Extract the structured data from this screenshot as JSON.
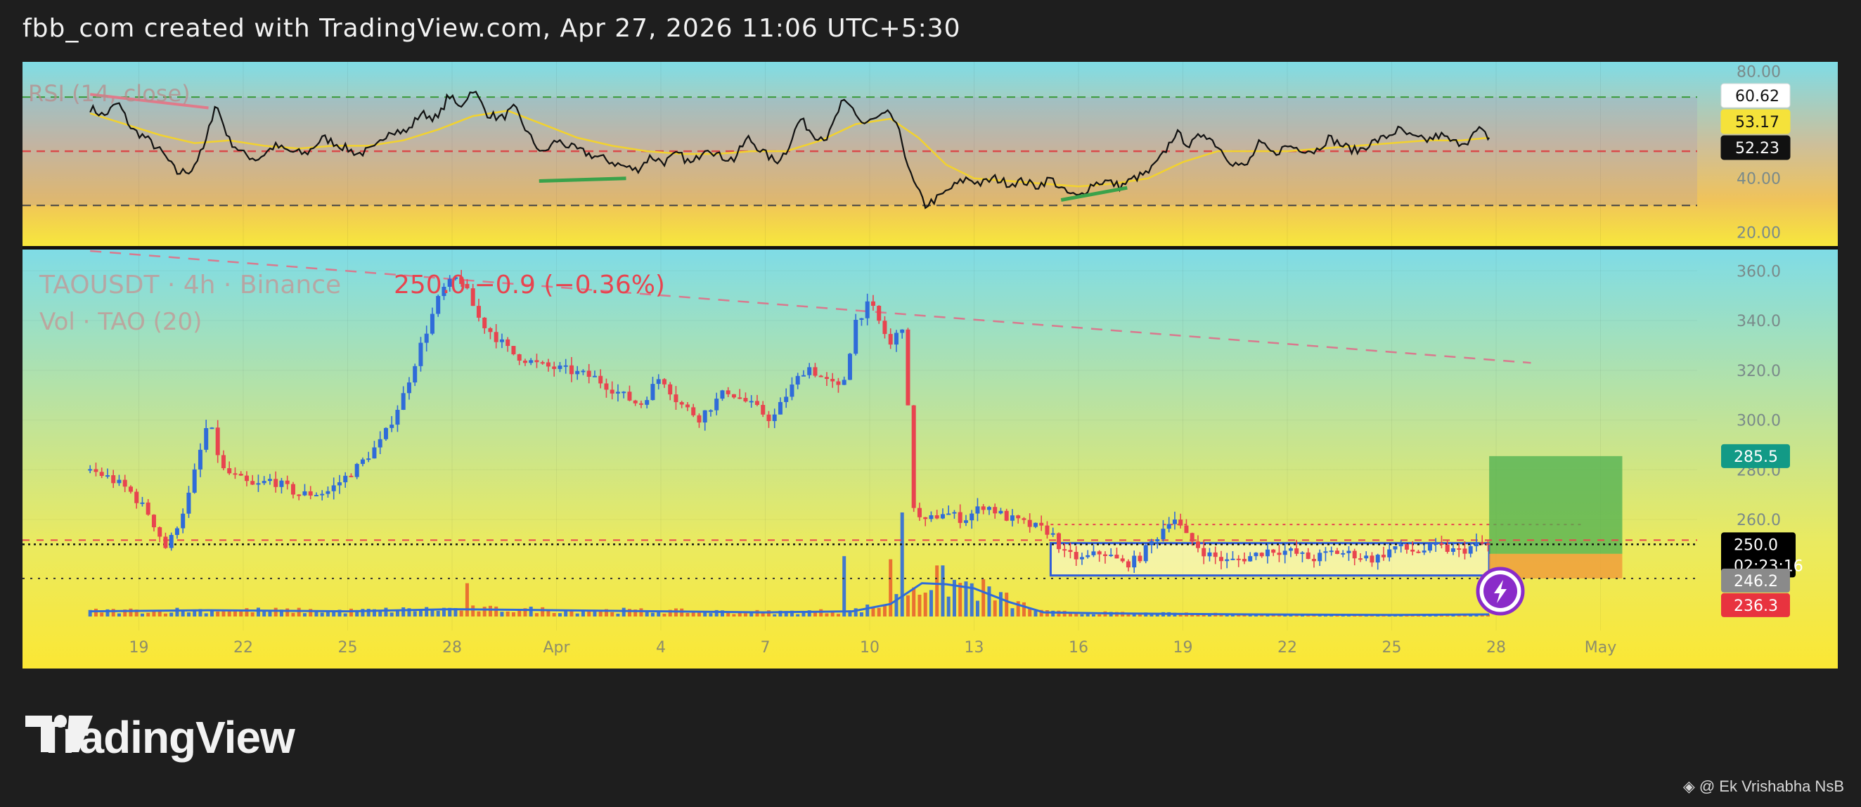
{
  "header": {
    "title": "fbb_com created with TradingView.com, Apr 27, 2026 11:06 UTC+5:30"
  },
  "brand": {
    "logo_text": "TradingView",
    "credit": "@ Ek Vrishabha NsB"
  },
  "colors": {
    "up": "#2f6bd9",
    "down": "#e8444f",
    "rsi_line": "#111111",
    "rsi_ma": "#f2d22e",
    "volume_ma": "#2f6bd9",
    "target": "#4caf50",
    "stop": "#ef9a3a"
  },
  "rsi": {
    "legend": "RSI (14, close)",
    "ylim": [
      15,
      83
    ],
    "ticks": [
      "60.00",
      "40.00",
      "20.00"
    ],
    "levels": [
      70,
      50,
      30
    ],
    "labels": {
      "rsi": "60.62",
      "ma": "53.17",
      "mid": "52.23"
    }
  },
  "price": {
    "legend_symbol": "TAOUSDT · 4h · Binance",
    "legend_values": "250.0 −0.9 (−0.36%)",
    "legend_volume": "Vol · TAO (20)",
    "ylim": [
      213,
      368
    ],
    "ticks": [
      "360.0",
      "340.0",
      "320.0",
      "300.0",
      "280.0",
      "260.0"
    ],
    "tick_values": [
      360,
      340,
      320,
      300,
      280,
      260
    ],
    "labels": {
      "target": "285.5",
      "current": "250.0",
      "countdown": "02:23:16",
      "entry": "246.2",
      "stop": "236.3"
    },
    "x_labels": [
      "19",
      "22",
      "25",
      "28",
      "Apr",
      "4",
      "7",
      "10",
      "13",
      "16",
      "19",
      "22",
      "25",
      "28",
      "May"
    ],
    "range_box": {
      "top": 250.5,
      "bottom": 237.5,
      "start_day": 14.2,
      "end_day": 26.8
    },
    "position": {
      "entry": 246.2,
      "target": 285.5,
      "stop": 236.3,
      "start_day": 26.8,
      "end_day": 28.1
    }
  },
  "chart_data": {
    "type": "candlestick",
    "symbol": "TAOUSDT",
    "timeframe": "4h",
    "x_reference": "days, 0 = Apr 1 2026, 4h candles",
    "path": [
      [
        -13.4,
        280
      ],
      [
        -12.9,
        277
      ],
      [
        -12.3,
        272
      ],
      [
        -11.7,
        262
      ],
      [
        -11.2,
        248
      ],
      [
        -10.6,
        268
      ],
      [
        -10.0,
        300
      ],
      [
        -9.6,
        280
      ],
      [
        -8.7,
        273
      ],
      [
        -8.2,
        276
      ],
      [
        -7.4,
        270
      ],
      [
        -6.6,
        271
      ],
      [
        -5.8,
        280
      ],
      [
        -5.0,
        292
      ],
      [
        -4.4,
        310
      ],
      [
        -3.9,
        330
      ],
      [
        -3.3,
        352
      ],
      [
        -2.8,
        358
      ],
      [
        -2.2,
        340
      ],
      [
        -1.3,
        327
      ],
      [
        -0.5,
        322
      ],
      [
        0.3,
        320
      ],
      [
        1.1,
        317
      ],
      [
        1.9,
        310
      ],
      [
        2.4,
        306
      ],
      [
        3.0,
        318
      ],
      [
        3.5,
        307
      ],
      [
        4.1,
        301
      ],
      [
        4.9,
        312
      ],
      [
        5.6,
        306
      ],
      [
        6.2,
        300
      ],
      [
        6.6,
        310
      ],
      [
        7.2,
        322
      ],
      [
        7.7,
        316
      ],
      [
        8.2,
        312
      ],
      [
        8.6,
        340
      ],
      [
        9.0,
        347
      ],
      [
        9.6,
        330
      ],
      [
        10.0,
        340
      ],
      [
        10.2,
        268
      ],
      [
        10.5,
        258
      ],
      [
        11.1,
        263
      ],
      [
        11.7,
        260
      ],
      [
        12.3,
        266
      ],
      [
        12.9,
        261
      ],
      [
        13.5,
        258
      ],
      [
        14.2,
        255
      ],
      [
        14.6,
        246
      ],
      [
        15.1,
        244
      ],
      [
        15.7,
        247
      ],
      [
        16.3,
        242
      ],
      [
        16.7,
        244
      ],
      [
        17.3,
        254
      ],
      [
        17.7,
        262
      ],
      [
        18.1,
        253
      ],
      [
        18.7,
        246
      ],
      [
        19.3,
        243
      ],
      [
        19.9,
        245
      ],
      [
        20.5,
        248
      ],
      [
        21.1,
        247
      ],
      [
        21.7,
        244
      ],
      [
        22.3,
        247
      ],
      [
        22.9,
        246
      ],
      [
        23.5,
        244
      ],
      [
        24.1,
        249
      ],
      [
        24.7,
        247
      ],
      [
        25.3,
        249
      ],
      [
        25.9,
        247
      ],
      [
        26.5,
        250
      ],
      [
        26.8,
        250
      ]
    ],
    "volume_ma": [
      [
        -13.4,
        0.05
      ],
      [
        -10.0,
        0.06
      ],
      [
        -6.0,
        0.05
      ],
      [
        -3.0,
        0.07
      ],
      [
        0.0,
        0.06
      ],
      [
        3.0,
        0.05
      ],
      [
        6.0,
        0.04
      ],
      [
        8.5,
        0.05
      ],
      [
        9.6,
        0.12
      ],
      [
        10.5,
        0.32
      ],
      [
        11.2,
        0.31
      ],
      [
        12.0,
        0.27
      ],
      [
        13.0,
        0.14
      ],
      [
        14.0,
        0.04
      ],
      [
        16.0,
        0.03
      ],
      [
        20.0,
        0.02
      ],
      [
        24.0,
        0.015
      ],
      [
        26.8,
        0.02
      ]
    ],
    "volume_spikes": [
      [
        10.0,
        1.0
      ],
      [
        9.6,
        0.55
      ],
      [
        8.3,
        0.58
      ],
      [
        10.3,
        0.28
      ],
      [
        -2.5,
        0.32
      ]
    ],
    "trendline": [
      [
        -13.4,
        368
      ],
      [
        28.0,
        323
      ]
    ],
    "last_price": 250.0,
    "change": -0.9,
    "change_pct": -0.36
  },
  "rsi_data": {
    "path": [
      [
        -13.4,
        66
      ],
      [
        -13.0,
        63
      ],
      [
        -12.6,
        68
      ],
      [
        -12.2,
        58
      ],
      [
        -11.8,
        55
      ],
      [
        -11.3,
        49
      ],
      [
        -10.9,
        42
      ],
      [
        -10.5,
        43
      ],
      [
        -10.1,
        52
      ],
      [
        -9.8,
        68
      ],
      [
        -9.4,
        54
      ],
      [
        -9.0,
        49
      ],
      [
        -8.6,
        47
      ],
      [
        -8.1,
        52
      ],
      [
        -7.7,
        50
      ],
      [
        -7.2,
        49
      ],
      [
        -6.7,
        55
      ],
      [
        -6.2,
        52
      ],
      [
        -5.7,
        49
      ],
      [
        -5.2,
        51
      ],
      [
        -4.8,
        58
      ],
      [
        -4.3,
        57
      ],
      [
        -3.9,
        64
      ],
      [
        -3.4,
        62
      ],
      [
        -3.1,
        71
      ],
      [
        -2.8,
        66
      ],
      [
        -2.4,
        73
      ],
      [
        -2.0,
        64
      ],
      [
        -1.6,
        62
      ],
      [
        -1.2,
        66
      ],
      [
        -0.8,
        56
      ],
      [
        -0.4,
        49
      ],
      [
        0.0,
        54
      ],
      [
        0.5,
        51
      ],
      [
        0.9,
        49
      ],
      [
        1.4,
        47
      ],
      [
        1.8,
        45
      ],
      [
        2.3,
        43
      ],
      [
        2.7,
        48
      ],
      [
        3.1,
        46
      ],
      [
        3.5,
        49
      ],
      [
        3.9,
        45
      ],
      [
        4.3,
        52
      ],
      [
        4.7,
        48
      ],
      [
        5.1,
        47
      ],
      [
        5.5,
        55
      ],
      [
        5.9,
        50
      ],
      [
        6.3,
        46
      ],
      [
        6.6,
        50
      ],
      [
        7.0,
        62
      ],
      [
        7.4,
        56
      ],
      [
        7.8,
        55
      ],
      [
        8.2,
        68
      ],
      [
        8.5,
        66
      ],
      [
        8.8,
        60
      ],
      [
        9.2,
        62
      ],
      [
        9.6,
        64
      ],
      [
        9.9,
        55
      ],
      [
        10.2,
        40
      ],
      [
        10.6,
        30
      ],
      [
        11.0,
        33
      ],
      [
        11.4,
        37
      ],
      [
        11.8,
        40
      ],
      [
        12.2,
        38
      ],
      [
        12.6,
        40
      ],
      [
        13.0,
        38
      ],
      [
        13.4,
        39
      ],
      [
        13.8,
        37
      ],
      [
        14.2,
        40
      ],
      [
        14.6,
        35
      ],
      [
        15.0,
        33
      ],
      [
        15.4,
        38
      ],
      [
        15.8,
        39
      ],
      [
        16.2,
        37
      ],
      [
        16.6,
        40
      ],
      [
        17.0,
        42
      ],
      [
        17.4,
        48
      ],
      [
        17.8,
        57
      ],
      [
        18.2,
        52
      ],
      [
        18.6,
        57
      ],
      [
        19.0,
        52
      ],
      [
        19.4,
        46
      ],
      [
        19.8,
        44
      ],
      [
        20.2,
        53
      ],
      [
        20.6,
        49
      ],
      [
        21.0,
        52
      ],
      [
        21.4,
        51
      ],
      [
        21.8,
        50
      ],
      [
        22.2,
        55
      ],
      [
        22.6,
        52
      ],
      [
        23.0,
        50
      ],
      [
        23.4,
        53
      ],
      [
        23.8,
        55
      ],
      [
        24.2,
        58
      ],
      [
        24.6,
        55
      ],
      [
        25.0,
        54
      ],
      [
        25.4,
        56
      ],
      [
        25.8,
        53
      ],
      [
        26.2,
        54
      ],
      [
        26.5,
        58
      ],
      [
        26.8,
        55
      ]
    ],
    "ma": [
      [
        -13.4,
        64
      ],
      [
        -12.4,
        60
      ],
      [
        -11.4,
        56
      ],
      [
        -10.4,
        53
      ],
      [
        -9.4,
        54
      ],
      [
        -8.4,
        52
      ],
      [
        -7.4,
        51
      ],
      [
        -6.4,
        52
      ],
      [
        -5.4,
        52
      ],
      [
        -4.4,
        54
      ],
      [
        -3.4,
        58
      ],
      [
        -2.4,
        63
      ],
      [
        -1.4,
        65
      ],
      [
        -0.4,
        60
      ],
      [
        0.6,
        55
      ],
      [
        1.6,
        52
      ],
      [
        2.6,
        50
      ],
      [
        3.6,
        49
      ],
      [
        4.6,
        49
      ],
      [
        5.6,
        50
      ],
      [
        6.6,
        50
      ],
      [
        7.6,
        54
      ],
      [
        8.6,
        60
      ],
      [
        9.6,
        62
      ],
      [
        10.4,
        55
      ],
      [
        11.2,
        45
      ],
      [
        12.0,
        40
      ],
      [
        13.0,
        39
      ],
      [
        14.0,
        38
      ],
      [
        15.0,
        37
      ],
      [
        16.0,
        38
      ],
      [
        17.0,
        40
      ],
      [
        18.0,
        46
      ],
      [
        19.0,
        50
      ],
      [
        20.0,
        50
      ],
      [
        21.0,
        50
      ],
      [
        22.0,
        51
      ],
      [
        23.0,
        52
      ],
      [
        24.0,
        53
      ],
      [
        25.0,
        54
      ],
      [
        26.0,
        54
      ],
      [
        26.8,
        55
      ]
    ],
    "divergences": [
      [
        [
          -0.5,
          39
        ],
        [
          2.0,
          40
        ]
      ],
      [
        [
          14.5,
          32
        ],
        [
          16.4,
          36.5
        ]
      ]
    ],
    "trend_top": [
      [
        -13.4,
        71
      ],
      [
        -10.0,
        66
      ]
    ]
  }
}
